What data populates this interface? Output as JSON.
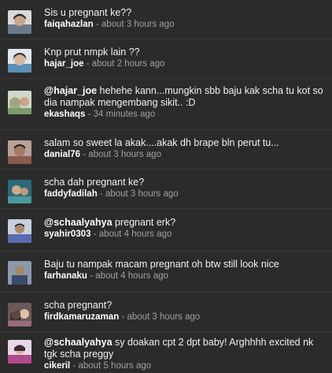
{
  "tweets": [
    {
      "text": "Sis u pregnant ke??",
      "user": "faiqahazlan",
      "time": "- about 3 hours ago",
      "avatar": "avatar-face-icon",
      "color": "#6a7a8c"
    },
    {
      "text": "Knp prut nmpk lain ??",
      "user": "hajar_joe",
      "time": "- about 2 hours ago",
      "avatar": "avatar-face-icon",
      "color": "#5a8fb8"
    },
    {
      "mention": "@hajar_joe",
      "text": " hehehe kann...mungkin sbb baju kak scha tu kot so dia nampak mengembang sikit.. :D",
      "user": "ekashaqs",
      "time": "- 34 minutes ago",
      "avatar": "avatar-face-icon",
      "color": "#7a9a6a"
    },
    {
      "text": "salam so sweet la akak....akak dh brape bln perut tu...",
      "user": "danial76",
      "time": "- about 3 hours ago",
      "avatar": "avatar-face-icon",
      "color": "#8a5a4a"
    },
    {
      "text": "scha dah pregnant ke?",
      "user": "faddyfadilah",
      "time": "- about 3 hours ago",
      "avatar": "avatar-face-icon",
      "color": "#4a9a9a"
    },
    {
      "mention": "@schaalyahya",
      "text": " pregnant erk?",
      "user": "syahir0303",
      "time": "- about 4 hours ago",
      "avatar": "avatar-face-icon",
      "color": "#5a6ab0"
    },
    {
      "text": "Baju tu nampak macam pregnant oh btw still look nice",
      "user": "farhanaku",
      "time": "- about 4 hours ago",
      "avatar": "avatar-face-icon",
      "color": "#3a4a6a"
    },
    {
      "text": "scha pregnant?",
      "user": "firdkamaruzaman",
      "time": "- about 3 hours ago",
      "avatar": "avatar-face-icon",
      "color": "#9a6a7a"
    },
    {
      "mention": "@schaalyahya",
      "text": " sy doakan cpt 2 dpt baby! Arghhhh excited nk tgk scha preggy",
      "user": "cikeril",
      "time": "- about 5 hours ago",
      "avatar": "avatar-face-icon",
      "color": "#b04a8a"
    }
  ]
}
